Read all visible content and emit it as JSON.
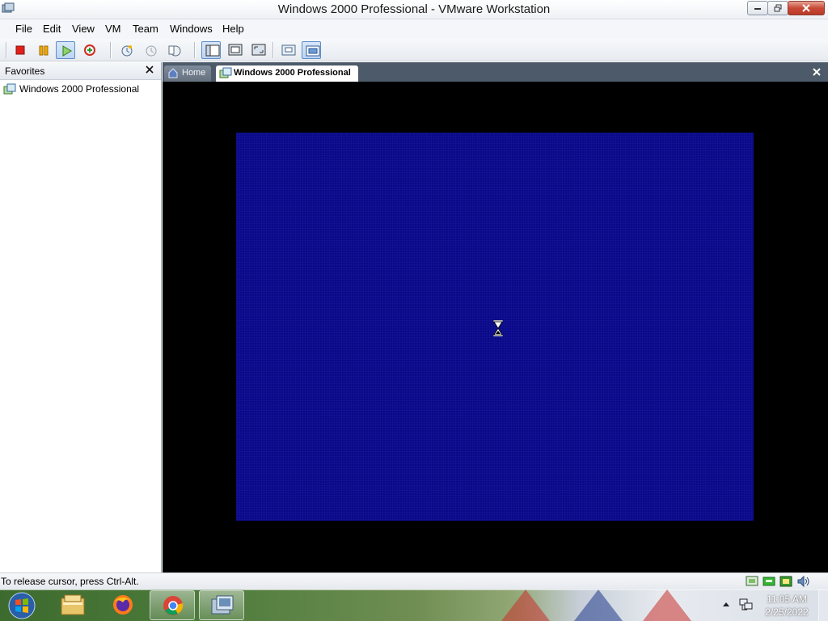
{
  "window": {
    "title": "Windows 2000 Professional - VMware Workstation"
  },
  "menu": {
    "items": [
      "File",
      "Edit",
      "View",
      "VM",
      "Team",
      "Windows",
      "Help"
    ]
  },
  "toolbar": {
    "buttons": [
      "stop-icon",
      "pause-icon",
      "play-icon",
      "reset-icon",
      "snapshot-icon",
      "revert-snapshot-icon",
      "snapshot-manager-icon",
      "sidebar-toggle-icon",
      "quick-switch-icon",
      "full-screen-icon",
      "console-view-icon",
      "summary-view-icon"
    ]
  },
  "sidebar": {
    "header": "Favorites",
    "items": [
      {
        "label": "Windows 2000 Professional",
        "icon": "vm-icon"
      }
    ]
  },
  "tabs": [
    {
      "label": "Home",
      "icon": "home-icon",
      "active": false
    },
    {
      "label": "Windows 2000 Professional",
      "icon": "vm-icon",
      "active": true
    }
  ],
  "vm": {
    "screen_color": "#0a0a88",
    "cursor": "hourglass-icon"
  },
  "status": {
    "message": "To release cursor, press Ctrl-Alt.",
    "device_icons": [
      "hard-disk-icon",
      "network-adapter-icon",
      "usb-icon",
      "sound-icon"
    ]
  },
  "taskbar": {
    "apps": [
      "explorer-icon",
      "firefox-icon",
      "chrome-icon",
      "vmware-icon"
    ],
    "clock": {
      "time": "11:05 AM",
      "date": "2/25/2022"
    }
  },
  "colors": {
    "tabstrip": "#4d5a6a",
    "guest_blue": "#0a0a88",
    "close_red": "#c84a36"
  }
}
